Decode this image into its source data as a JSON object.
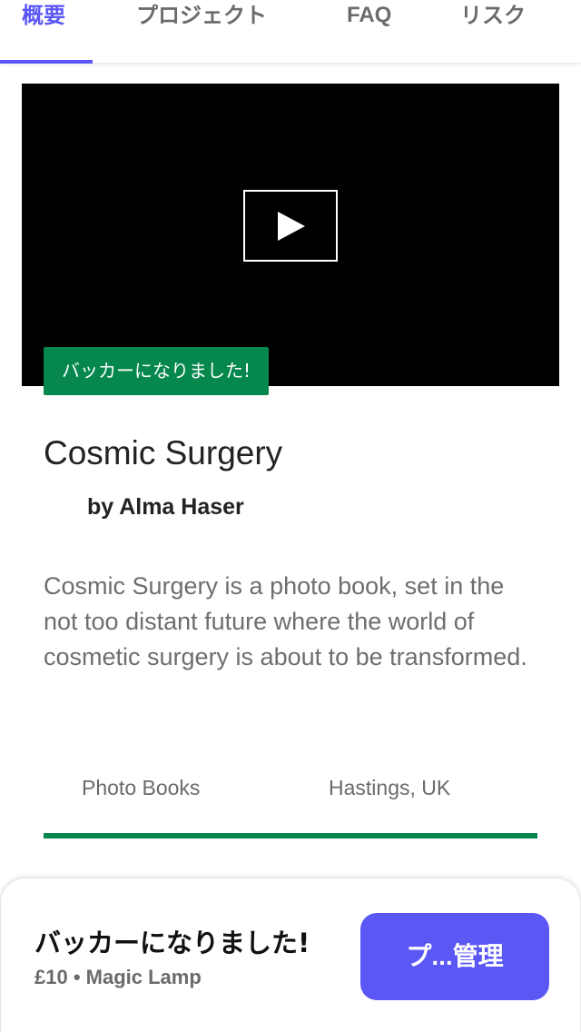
{
  "tabs": {
    "overview": "概要",
    "project": "プロジェクト",
    "faq": "FAQ",
    "risk": "リスク"
  },
  "video": {
    "play_icon": "play-icon",
    "backer_badge": "バッカーになりました!"
  },
  "project": {
    "title": "Cosmic Surgery",
    "byline": "by Alma Haser",
    "description": "Cosmic Surgery is a photo book, set in the not too distant future where the world of cosmetic surgery is about to be transformed.",
    "category": "Photo Books",
    "location": "Hastings, UK",
    "funding_progress": 1.0
  },
  "panel": {
    "status": "バッカーになりました!",
    "reward": "£10 • Magic Lamp",
    "manage_button": "プ...管理"
  },
  "colors": {
    "accent": "#5b57f5",
    "success": "#05874d"
  }
}
